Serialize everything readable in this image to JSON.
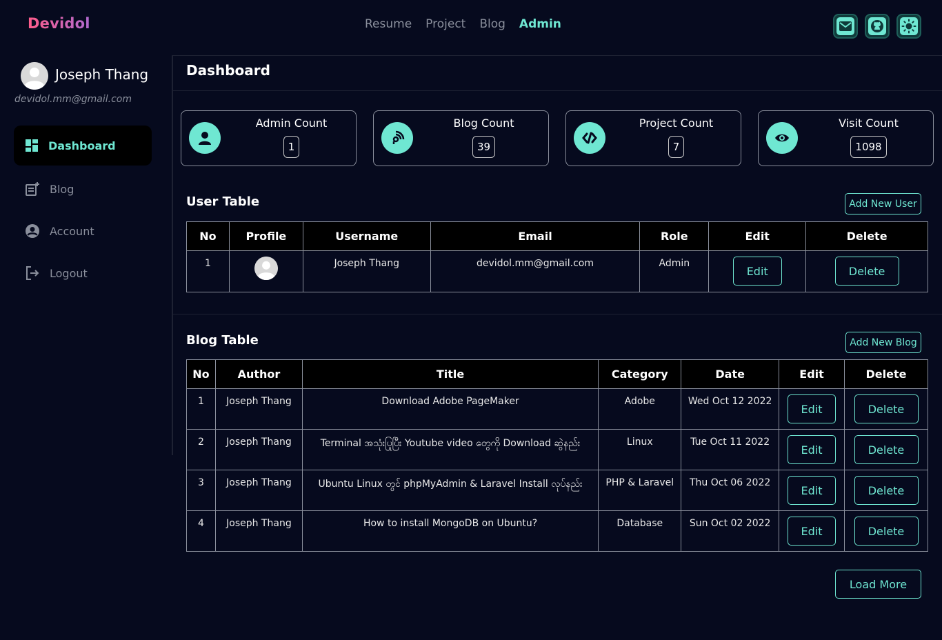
{
  "brand": "Devidol",
  "nav": {
    "links": [
      "Resume",
      "Project",
      "Blog",
      "Admin"
    ],
    "active": "Admin",
    "icons": [
      "mail-icon",
      "github-icon",
      "theme-toggle-icon"
    ]
  },
  "colors": {
    "accent": "#6fe7d2",
    "background": "#060a1e",
    "brand_gradient_start": "#ff5c8a",
    "brand_gradient_end": "#b06ad0"
  },
  "sidebar": {
    "user_name": "Joseph Thang",
    "user_email": "devidol.mm@gmail.com",
    "items": [
      {
        "label": "Dashboard",
        "icon": "dashboard-icon",
        "active": true
      },
      {
        "label": "Blog",
        "icon": "blog-post-icon",
        "active": false
      },
      {
        "label": "Account",
        "icon": "account-icon",
        "active": false
      },
      {
        "label": "Logout",
        "icon": "logout-icon",
        "active": false
      }
    ]
  },
  "page_title": "Dashboard",
  "stats": [
    {
      "label": "Admin Count",
      "value": "1",
      "icon": "user-icon"
    },
    {
      "label": "Blog Count",
      "value": "39",
      "icon": "blog-feed-icon"
    },
    {
      "label": "Project Count",
      "value": "7",
      "icon": "code-icon"
    },
    {
      "label": "Visit Count",
      "value": "1098",
      "icon": "eye-icon"
    }
  ],
  "user_table": {
    "title": "User Table",
    "add_label": "Add New User",
    "columns": [
      "No",
      "Profile",
      "Username",
      "Email",
      "Role",
      "Edit",
      "Delete"
    ],
    "rows": [
      {
        "no": "1",
        "username": "Joseph Thang",
        "email": "devidol.mm@gmail.com",
        "role": "Admin",
        "edit": "Edit",
        "delete": "Delete"
      }
    ]
  },
  "blog_table": {
    "title": "Blog Table",
    "add_label": "Add New Blog",
    "columns": [
      "No",
      "Author",
      "Title",
      "Category",
      "Date",
      "Edit",
      "Delete"
    ],
    "rows": [
      {
        "no": "1",
        "author": "Joseph Thang",
        "title": "Download Adobe PageMaker",
        "category": "Adobe",
        "date": "Wed Oct 12 2022",
        "edit": "Edit",
        "delete": "Delete"
      },
      {
        "no": "2",
        "author": "Joseph Thang",
        "title": "Terminal အသုံးပြုပြီး Youtube video တွေကို Download ဆွဲနည်း",
        "category": "Linux",
        "date": "Tue Oct 11 2022",
        "edit": "Edit",
        "delete": "Delete"
      },
      {
        "no": "3",
        "author": "Joseph Thang",
        "title": "Ubuntu Linux တွင် phpMyAdmin & Laravel Install လုပ်နည်း",
        "category": "PHP & Laravel",
        "date": "Thu Oct 06 2022",
        "edit": "Edit",
        "delete": "Delete"
      },
      {
        "no": "4",
        "author": "Joseph Thang",
        "title": "How to install MongoDB on Ubuntu?",
        "category": "Database",
        "date": "Sun Oct 02 2022",
        "edit": "Edit",
        "delete": "Delete"
      }
    ]
  },
  "load_more_label": "Load More"
}
